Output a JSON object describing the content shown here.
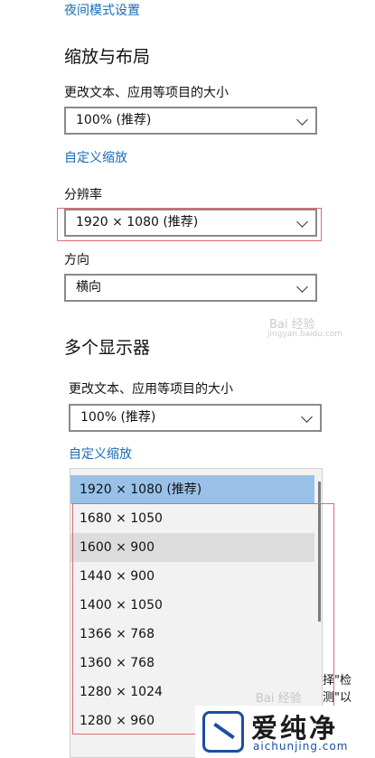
{
  "night_light_link": "夜间模式设置",
  "scale_section": {
    "title": "缩放与布局",
    "text_size_label": "更改文本、应用等项目的大小",
    "text_size_value": "100% (推荐)",
    "custom_scale_link": "自定义缩放",
    "resolution_label": "分辨率",
    "resolution_value": "1920 × 1080 (推荐)",
    "orientation_label": "方向",
    "orientation_value": "横向"
  },
  "multi_display": {
    "title": "多个显示器",
    "text_size_label": "更改文本、应用等项目的大小",
    "text_size_value": "100% (推荐)",
    "custom_scale_link": "自定义缩放"
  },
  "resolution_options": [
    "1920 × 1080 (推荐)",
    "1680 × 1050",
    "1600 × 900",
    "1440 × 900",
    "1400 × 1050",
    "1366 × 768",
    "1360 × 768",
    "1280 × 1024",
    "1280 × 960"
  ],
  "partial_text": "择\"检测\"以",
  "watermark": {
    "baidu_mid": "Bai 经验",
    "baidu_sub": "jingyan.baidu.com",
    "baidu_bottom": "Bai 经验"
  },
  "logo": {
    "cn": "爱纯净",
    "en": "aichunjing.com"
  }
}
